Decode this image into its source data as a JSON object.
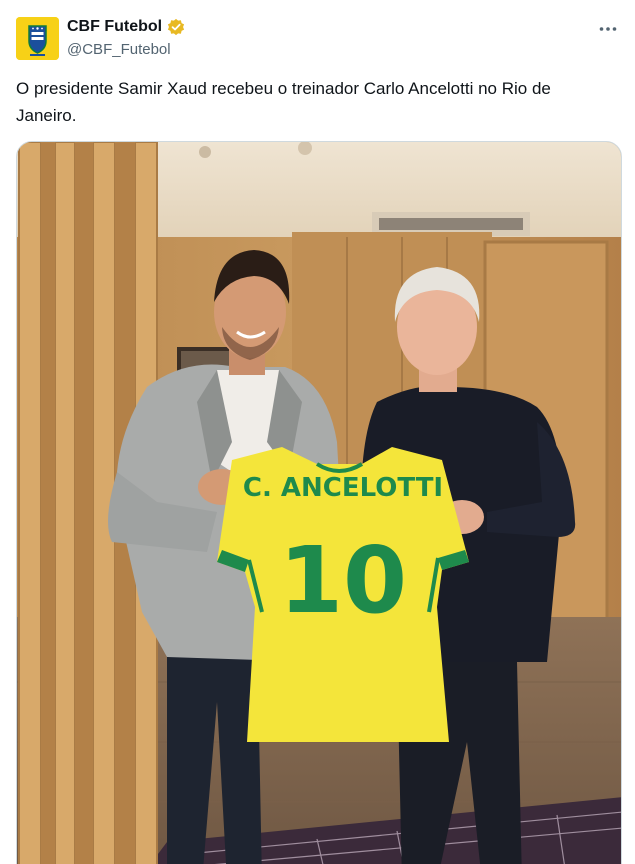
{
  "account": {
    "display_name": "CBF Futebol",
    "handle": "@CBF_Futebol",
    "verified": true,
    "avatar_icon": "cbf-crest-logo"
  },
  "header": {
    "more_icon": "more-horizontal-icon"
  },
  "tweet": {
    "text": "O presidente Samir Xaud recebeu o treinador Carlo Ancelotti no Rio de Janeiro."
  },
  "media": {
    "jersey_name": "C. ANCELOTTI",
    "jersey_number": "10"
  },
  "colors": {
    "verified_gold": "#e8b923",
    "jersey_yellow": "#f4e53a",
    "jersey_green": "#1e8a4c",
    "brand_yellow": "#f7d117",
    "brand_blue": "#1b4f9c"
  }
}
